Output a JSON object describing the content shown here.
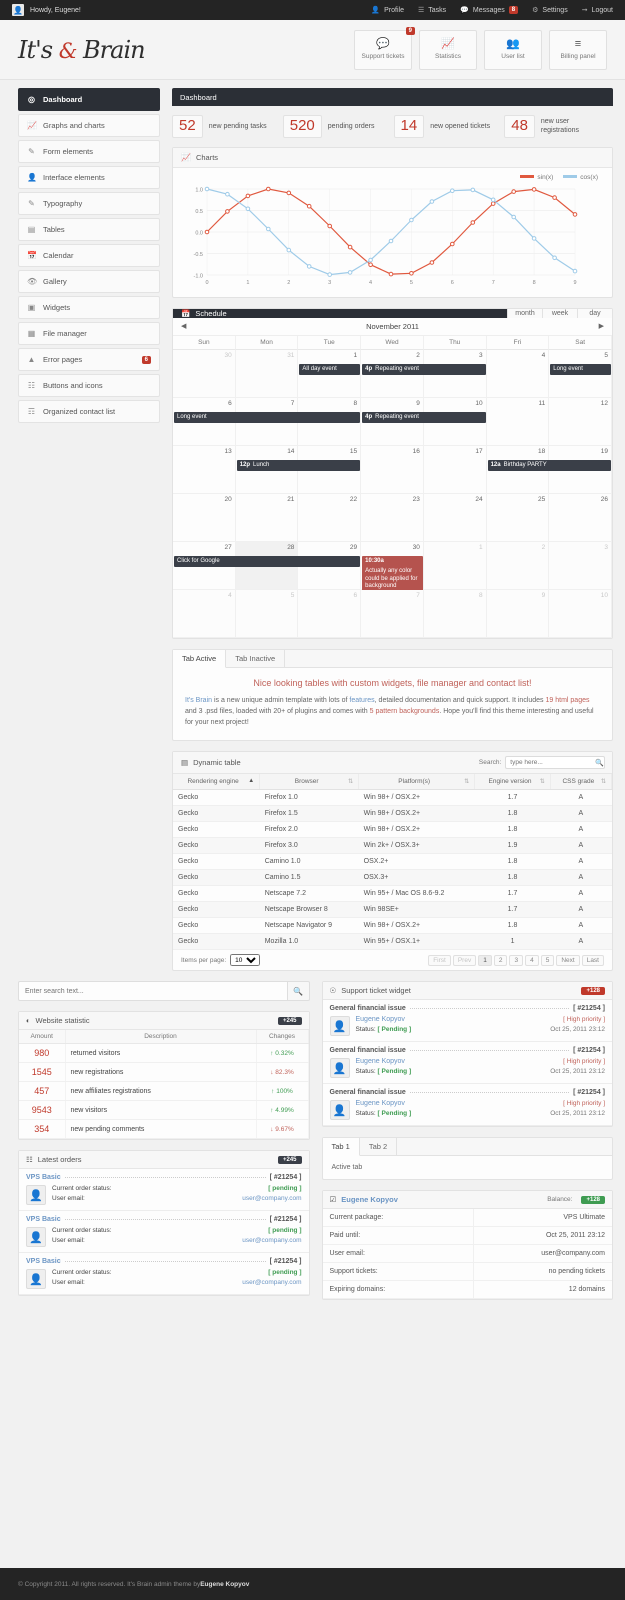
{
  "topbar": {
    "howdy": "Howdy, Eugene!",
    "avatar_icon": "user-avatar-icon",
    "nav": [
      {
        "label": "Profile",
        "icon": "person-icon"
      },
      {
        "label": "Tasks",
        "icon": "list-icon"
      },
      {
        "label": "Messages",
        "icon": "comment-icon",
        "badge": "8"
      },
      {
        "label": "Settings",
        "icon": "gear-icon"
      },
      {
        "label": "Logout",
        "icon": "exit-icon"
      }
    ]
  },
  "header": {
    "logo_left": "It's",
    "logo_amp": "&",
    "logo_right": "Brain",
    "buttons": [
      {
        "label": "Support tickets",
        "icon": "comment-dots-icon",
        "badge": "9"
      },
      {
        "label": "Statistics",
        "icon": "chart-line-icon"
      },
      {
        "label": "User list",
        "icon": "users-icon"
      },
      {
        "label": "Billing panel",
        "icon": "billing-icon"
      }
    ]
  },
  "sidebar": {
    "items": [
      {
        "label": "Dashboard",
        "icon": "dashboard-icon",
        "active": true
      },
      {
        "label": "Graphs and charts",
        "icon": "chart-icon"
      },
      {
        "label": "Form elements",
        "icon": "pencil-icon"
      },
      {
        "label": "Interface elements",
        "icon": "person-icon"
      },
      {
        "label": "Typography",
        "icon": "edit-square-icon"
      },
      {
        "label": "Tables",
        "icon": "table-icon"
      },
      {
        "label": "Calendar",
        "icon": "calendar-icon"
      },
      {
        "label": "Gallery",
        "icon": "eye-icon"
      },
      {
        "label": "Widgets",
        "icon": "widget-icon"
      },
      {
        "label": "File manager",
        "icon": "folder-icon"
      },
      {
        "label": "Error pages",
        "icon": "warning-icon",
        "badge": "6"
      },
      {
        "label": "Buttons and icons",
        "icon": "grid-icon"
      },
      {
        "label": "Organized contact list",
        "icon": "contacts-icon"
      }
    ]
  },
  "dashboard": {
    "title": "Dashboard",
    "stats": [
      {
        "number": "52",
        "label": "new pending tasks"
      },
      {
        "number": "520",
        "label": "pending orders"
      },
      {
        "number": "14",
        "label": "new opened tickets"
      },
      {
        "number": "48",
        "label": "new user registrations"
      }
    ]
  },
  "charts_panel": {
    "title": "Charts",
    "icon": "chart-line-icon"
  },
  "chart_data": {
    "type": "line",
    "title": "Charts",
    "xlabel": "",
    "ylabel": "",
    "xlim": [
      0,
      9
    ],
    "ylim": [
      -1.0,
      1.0
    ],
    "xticks": [
      "0",
      "1",
      "2",
      "3",
      "4",
      "5",
      "6",
      "7",
      "8",
      "9"
    ],
    "yticks": [
      "-1.0",
      "-0.5",
      "0.0",
      "0.5",
      "1.0"
    ],
    "grid": true,
    "legend_position": "top-right",
    "x": [
      0,
      0.5,
      1,
      1.5,
      2,
      2.5,
      3,
      3.5,
      4,
      4.5,
      5,
      5.5,
      6,
      6.5,
      7,
      7.5,
      8,
      8.5,
      9
    ],
    "series": [
      {
        "name": "sin(x)",
        "color": "#e0593f",
        "values": [
          0.0,
          0.48,
          0.84,
          1.0,
          0.91,
          0.6,
          0.14,
          -0.35,
          -0.76,
          -0.98,
          -0.96,
          -0.71,
          -0.28,
          0.22,
          0.66,
          0.94,
          0.99,
          0.8,
          0.41
        ]
      },
      {
        "name": "cos(x)",
        "color": "#9fcbe8",
        "values": [
          1.0,
          0.88,
          0.54,
          0.07,
          -0.42,
          -0.8,
          -0.99,
          -0.94,
          -0.65,
          -0.21,
          0.28,
          0.71,
          0.96,
          0.98,
          0.75,
          0.35,
          -0.15,
          -0.6,
          -0.91
        ]
      }
    ]
  },
  "schedule": {
    "title": "Schedule",
    "icon": "calendar-icon",
    "views": [
      "month",
      "week",
      "day"
    ],
    "month_title": "November 2011",
    "prev_icon": "chevron-left-icon",
    "next_icon": "chevron-right-icon",
    "dow": [
      "Sun",
      "Mon",
      "Tue",
      "Wed",
      "Thu",
      "Fri",
      "Sat"
    ],
    "weeks": [
      [
        {
          "d": "30",
          "other": true
        },
        {
          "d": "31",
          "other": true
        },
        {
          "d": "1"
        },
        {
          "d": "2"
        },
        {
          "d": "3"
        },
        {
          "d": "4"
        },
        {
          "d": "5"
        }
      ],
      [
        {
          "d": "6"
        },
        {
          "d": "7"
        },
        {
          "d": "8"
        },
        {
          "d": "9"
        },
        {
          "d": "10"
        },
        {
          "d": "11"
        },
        {
          "d": "12"
        }
      ],
      [
        {
          "d": "13"
        },
        {
          "d": "14"
        },
        {
          "d": "15"
        },
        {
          "d": "16"
        },
        {
          "d": "17"
        },
        {
          "d": "18"
        },
        {
          "d": "19"
        }
      ],
      [
        {
          "d": "20"
        },
        {
          "d": "21"
        },
        {
          "d": "22"
        },
        {
          "d": "23"
        },
        {
          "d": "24"
        },
        {
          "d": "25"
        },
        {
          "d": "26"
        }
      ],
      [
        {
          "d": "27"
        },
        {
          "d": "28",
          "sel": true
        },
        {
          "d": "29"
        },
        {
          "d": "30"
        },
        {
          "d": "1",
          "other": true
        },
        {
          "d": "2",
          "other": true
        },
        {
          "d": "3",
          "other": true
        }
      ],
      [
        {
          "d": "4",
          "other": true
        },
        {
          "d": "5",
          "other": true
        },
        {
          "d": "6",
          "other": true
        },
        {
          "d": "7",
          "other": true
        },
        {
          "d": "8",
          "other": true
        },
        {
          "d": "9",
          "other": true
        },
        {
          "d": "10",
          "other": true
        }
      ]
    ],
    "events": [
      {
        "time": "",
        "text": "All day event",
        "row": 0,
        "col": 2,
        "span": 1,
        "red": false
      },
      {
        "time": "4p",
        "text": "Repeating event",
        "row": 0,
        "col": 3,
        "span": 2,
        "red": false
      },
      {
        "time": "",
        "text": "Long event",
        "row": 0,
        "col": 6,
        "span": 1,
        "red": false
      },
      {
        "time": "",
        "text": "Long event",
        "row": 1,
        "col": 0,
        "span": 3,
        "red": false
      },
      {
        "time": "4p",
        "text": "Repeating event",
        "row": 1,
        "col": 3,
        "span": 2,
        "red": false
      },
      {
        "time": "12p",
        "text": "Lunch",
        "row": 2,
        "col": 1,
        "span": 2,
        "red": false
      },
      {
        "time": "12a",
        "text": "Birthday PARTY",
        "row": 2,
        "col": 5,
        "span": 2,
        "red": false
      },
      {
        "time": "",
        "text": "Click for Google",
        "row": 4,
        "col": 0,
        "span": 3,
        "red": false
      },
      {
        "time": "10:30a",
        "text": "Actually any color could be applied for background",
        "row": 4,
        "col": 3,
        "span": 1,
        "red": true
      }
    ]
  },
  "tabs_panel": {
    "tabs": [
      {
        "label": "Tab Active",
        "active": true
      },
      {
        "label": "Tab Inactive",
        "active": false
      }
    ],
    "heading": "Nice looking tables with custom widgets, file manager and contact list!",
    "para": {
      "link1": "It's Brain",
      "t1": " is a new unique admin template with lots of ",
      "link2": "features",
      "t2": ", detailed documentation and quick support. It includes ",
      "link3": "19 html pages",
      "t3": " and 3 .psd files, loaded with 20+ of plugins and comes with ",
      "link4": "5 pattern backgrounds",
      "t4": ". Hope you'll find this theme interesting and useful for your next project!"
    }
  },
  "dynamic_table": {
    "title": "Dynamic table",
    "icon": "table-icon",
    "search_label": "Search:",
    "search_placeholder": "type here...",
    "search_icon": "search-icon",
    "columns": [
      "Rendering engine",
      "Browser",
      "Platform(s)",
      "Engine version",
      "CSS grade"
    ],
    "rows": [
      [
        "Gecko",
        "Firefox 1.0",
        "Win 98+ / OSX.2+",
        "1.7",
        "A"
      ],
      [
        "Gecko",
        "Firefox 1.5",
        "Win 98+ / OSX.2+",
        "1.8",
        "A"
      ],
      [
        "Gecko",
        "Firefox 2.0",
        "Win 98+ / OSX.2+",
        "1.8",
        "A"
      ],
      [
        "Gecko",
        "Firefox 3.0",
        "Win 2k+ / OSX.3+",
        "1.9",
        "A"
      ],
      [
        "Gecko",
        "Camino 1.0",
        "OSX.2+",
        "1.8",
        "A"
      ],
      [
        "Gecko",
        "Camino 1.5",
        "OSX.3+",
        "1.8",
        "A"
      ],
      [
        "Gecko",
        "Netscape 7.2",
        "Win 95+ / Mac OS 8.6-9.2",
        "1.7",
        "A"
      ],
      [
        "Gecko",
        "Netscape Browser 8",
        "Win 98SE+",
        "1.7",
        "A"
      ],
      [
        "Gecko",
        "Netscape Navigator 9",
        "Win 98+ / OSX.2+",
        "1.8",
        "A"
      ],
      [
        "Gecko",
        "Mozilla 1.0",
        "Win 95+ / OSX.1+",
        "1",
        "A"
      ]
    ],
    "items_per_page_label": "Items per page:",
    "items_per_page_value": "10",
    "pager": [
      "First",
      "Prev",
      "1",
      "2",
      "3",
      "4",
      "5",
      "Next",
      "Last"
    ],
    "pager_current": "1"
  },
  "search_widget": {
    "placeholder": "Enter search text...",
    "icon": "search-icon"
  },
  "website_statistic": {
    "title": "Website statistic",
    "icon": "pie-chart-icon",
    "badge": "+245",
    "columns": [
      "Amount",
      "Description",
      "Changes"
    ],
    "rows": [
      {
        "amount": "980",
        "description": "returned visitors",
        "change": "0.32%",
        "dir": "up"
      },
      {
        "amount": "1545",
        "description": "new registrations",
        "change": "82.3%",
        "dir": "down"
      },
      {
        "amount": "457",
        "description": "new affiliates registrations",
        "change": "100%",
        "dir": "up"
      },
      {
        "amount": "9543",
        "description": "new visitors",
        "change": "4.99%",
        "dir": "up"
      },
      {
        "amount": "354",
        "description": "new pending comments",
        "change": "9.67%",
        "dir": "down"
      }
    ]
  },
  "support_widget": {
    "title": "Support ticket widget",
    "icon": "lifebuoy-icon",
    "badge": "+128",
    "tickets": [
      {
        "subject": "General financial issue",
        "id": "[ #21254 ]",
        "user": "Eugene Kopyov",
        "priority": "[ High priority ]",
        "status_label": "Status:",
        "status": "[ Pending ]",
        "date": "Oct 25, 2011 23:12",
        "avatar_icon": "user-avatar-icon"
      },
      {
        "subject": "General financial issue",
        "id": "[ #21254 ]",
        "user": "Eugene Kopyov",
        "priority": "[ High priority ]",
        "status_label": "Status:",
        "status": "[ Pending ]",
        "date": "Oct 25, 2011 23:12",
        "avatar_icon": "user-avatar-icon"
      },
      {
        "subject": "General financial issue",
        "id": "[ #21254 ]",
        "user": "Eugene Kopyov",
        "priority": "[ High priority ]",
        "status_label": "Status:",
        "status": "[ Pending ]",
        "date": "Oct 25, 2011 23:12",
        "avatar_icon": "user-avatar-icon"
      }
    ]
  },
  "latest_orders": {
    "title": "Latest orders",
    "icon": "cart-icon",
    "badge": "+245",
    "orders": [
      {
        "name": "VPS Basic",
        "id": "[ #21254 ]",
        "status_label": "Current order status:",
        "status": "[ pending ]",
        "email_label": "User email:",
        "email": "user@company.com",
        "avatar_icon": "user-avatar-icon"
      },
      {
        "name": "VPS Basic",
        "id": "[ #21254 ]",
        "status_label": "Current order status:",
        "status": "[ pending ]",
        "email_label": "User email:",
        "email": "user@company.com",
        "avatar_icon": "user-avatar-icon"
      },
      {
        "name": "VPS Basic",
        "id": "[ #21254 ]",
        "status_label": "Current order status:",
        "status": "[ pending ]",
        "email_label": "User email:",
        "email": "user@company.com",
        "avatar_icon": "user-avatar-icon"
      }
    ]
  },
  "mini_tabs": {
    "tabs": [
      {
        "label": "Tab 1",
        "active": true
      },
      {
        "label": "Tab 2",
        "active": false
      }
    ],
    "body": "Active tab"
  },
  "profile_widget": {
    "check_icon": "check-icon",
    "name": "Eugene Kopyov",
    "balance_label": "Balance:",
    "balance": "+128",
    "rows": [
      {
        "key": "Current package:",
        "value": "VPS Ultimate",
        "style": "red"
      },
      {
        "key": "Paid until:",
        "value": "Oct 25, 2011  23:12",
        "style": "plain"
      },
      {
        "key": "User email:",
        "value": "user@company.com",
        "style": "blue"
      },
      {
        "key": "Support tickets:",
        "value": "no pending tickets",
        "style": "green"
      },
      {
        "key": "Expiring domains:",
        "value": "12 domains",
        "style": "plain"
      }
    ]
  },
  "footer": {
    "text": "© Copyright 2011. All rights reserved. It's Brain admin theme by ",
    "author": "Eugene Kopyov"
  }
}
